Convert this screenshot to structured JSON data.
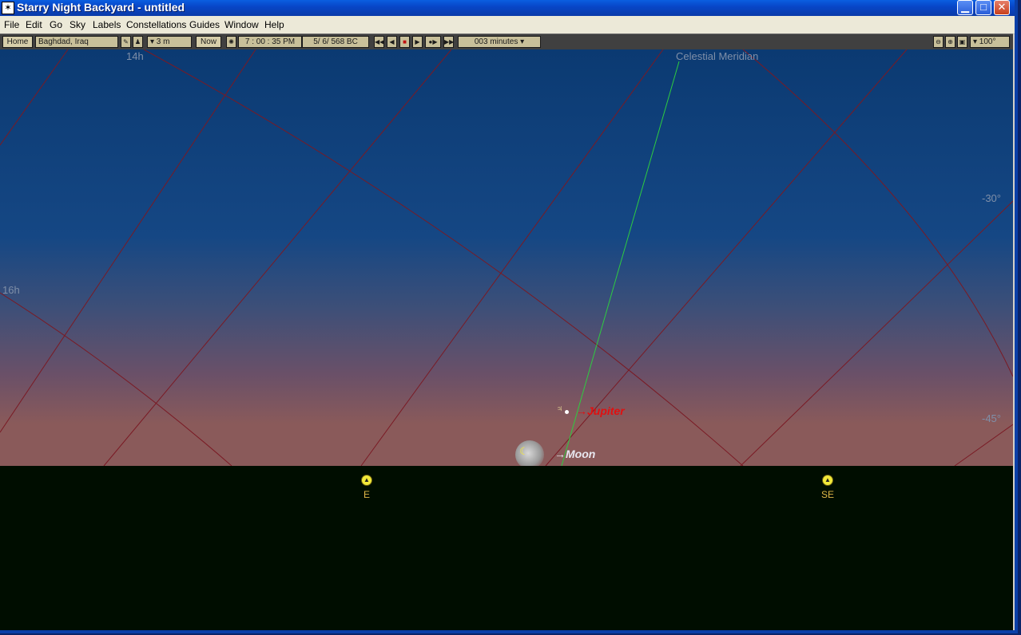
{
  "window": {
    "title": "Starry Night Backyard - untitled",
    "minimize_glyph": "▁",
    "maximize_glyph": "□",
    "close_glyph": "✕"
  },
  "menu": {
    "items": [
      "File",
      "Edit",
      "Go",
      "Sky",
      "Labels",
      "Constellations",
      "Guides",
      "Window",
      "Help"
    ]
  },
  "toolbar": {
    "home_label": "Home",
    "location": "Baghdad, Iraq",
    "elevation": "▾ 3 m",
    "now_label": "Now",
    "time": "7 : 00 : 35 PM",
    "date": "5/   6/   568 BC",
    "time_step": "003 minutes ▾",
    "zoom_level": "▾ 100°"
  },
  "sky": {
    "hour_labels": {
      "h14": "14h",
      "h16": "16h"
    },
    "dec_labels": {
      "m30": "-30°",
      "m45": "-45°"
    },
    "meridian_label": "Celestial Meridian",
    "jupiter": {
      "label": "Jupiter",
      "symbol": "♃"
    },
    "moon": {
      "label": "Moon",
      "symbol": "☾"
    },
    "compass": {
      "east": "E",
      "southeast": "SE"
    }
  },
  "colors": {
    "sky_top": "#0b3a72",
    "sky_mid": "#1a4e8a",
    "sky_horizon": "#8a5a5a",
    "ground": "#000d00",
    "grid_line": "#7a1a24",
    "meridian_line": "#2ecc40",
    "jupiter_label": "#e01010",
    "compass_text": "#e0b848"
  }
}
